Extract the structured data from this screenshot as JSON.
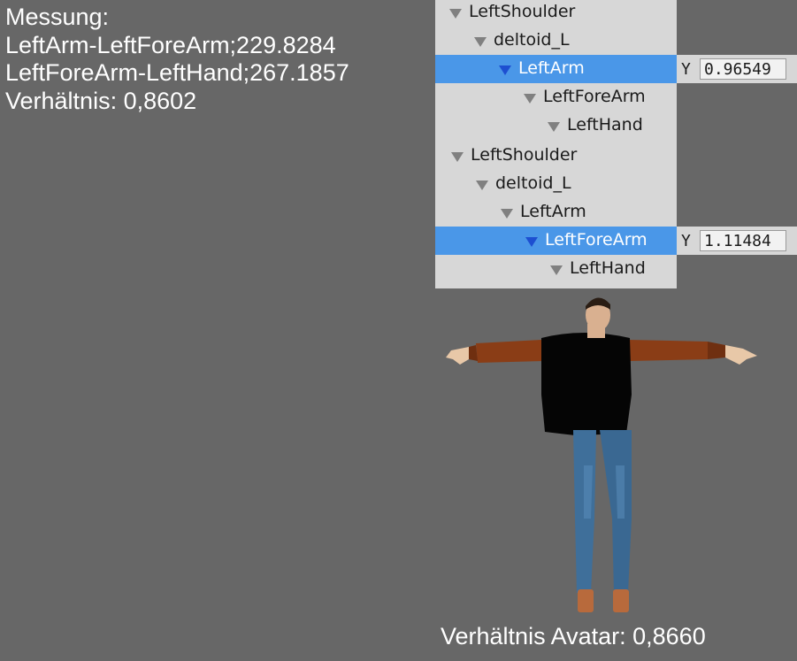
{
  "measurement": {
    "heading": "Messung:",
    "line1": "LeftArm-LeftForeArm;229.8284",
    "line2": "LeftForeArm-LeftHand;267.1857",
    "ratio": "Verhältnis: 0,8602"
  },
  "hierarchy_top": [
    {
      "label": "LeftShoulder",
      "selected": false
    },
    {
      "label": "deltoid_L",
      "selected": false
    },
    {
      "label": "LeftArm",
      "selected": true
    },
    {
      "label": "LeftForeArm",
      "selected": false
    },
    {
      "label": "LeftHand",
      "selected": false
    }
  ],
  "hierarchy_bottom": [
    {
      "label": "LeftShoulder",
      "selected": false
    },
    {
      "label": "deltoid_L",
      "selected": false
    },
    {
      "label": "LeftArm",
      "selected": false
    },
    {
      "label": "LeftForeArm",
      "selected": true
    },
    {
      "label": "LeftHand",
      "selected": false
    }
  ],
  "inspector": {
    "top": {
      "axis": "Y",
      "value": "0.96549"
    },
    "bottom": {
      "axis": "Y",
      "value": "1.11484"
    }
  },
  "avatar_ratio": "Verhältnis Avatar: 0,8660",
  "colors": {
    "viewport_bg": "#676767",
    "panel_bg": "#d7d7d7",
    "selection": "#4a97e8"
  },
  "icons": [
    "expand-triangle-icon",
    "avatar-figure"
  ]
}
